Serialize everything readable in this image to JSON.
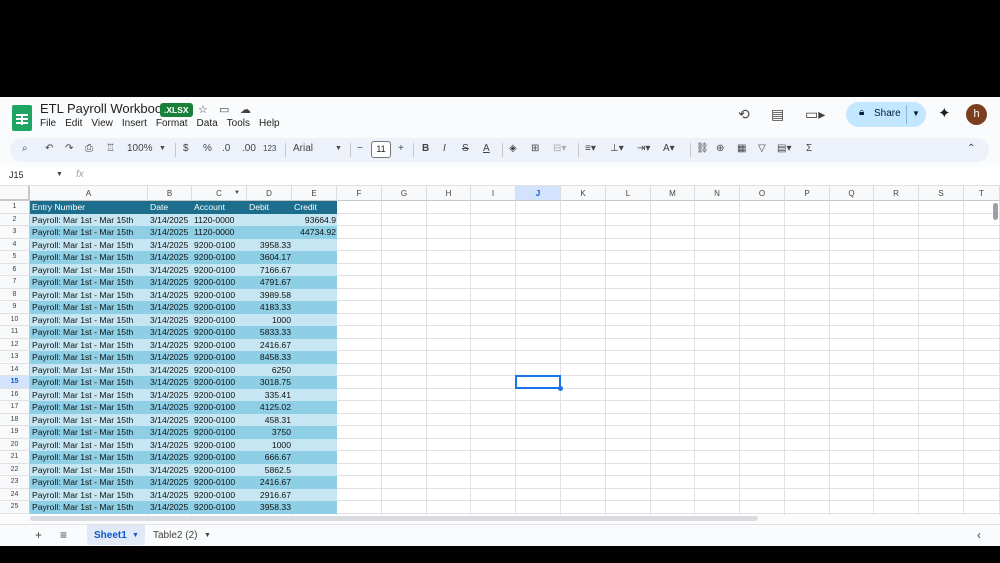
{
  "title": "ETL Payroll Workbook",
  "badge": ".XLSX",
  "menu": [
    "File",
    "Edit",
    "View",
    "Insert",
    "Format",
    "Data",
    "Tools",
    "Help"
  ],
  "share_label": "Share",
  "avatar_initial": "h",
  "toolbar": {
    "zoom": "100%",
    "currency": "$",
    "percent": "%",
    "dec_less": ".0",
    "dec_more": ".00",
    "numfmt": "123",
    "font": "Arial",
    "font_size": "11"
  },
  "name_box": "J15",
  "fx_label": "fx",
  "columns": [
    "A",
    "B",
    "C",
    "D",
    "E",
    "F",
    "G",
    "H",
    "I",
    "J",
    "K",
    "L",
    "M",
    "N",
    "O",
    "P",
    "Q",
    "R",
    "S",
    "T"
  ],
  "selected_column": "J",
  "selected_row": "15",
  "table_header": [
    "Entry Number",
    "Date",
    "Account",
    "Debit",
    "Credit"
  ],
  "rows": [
    [
      "Payroll: Mar 1st - Mar 15th",
      "3/14/2025",
      "1120-0000",
      "",
      "93664.9"
    ],
    [
      "Payroll: Mar 1st - Mar 15th",
      "3/14/2025",
      "1120-0000",
      "",
      "44734.92"
    ],
    [
      "Payroll: Mar 1st - Mar 15th",
      "3/14/2025",
      "9200-0100",
      "3958.33",
      ""
    ],
    [
      "Payroll: Mar 1st - Mar 15th",
      "3/14/2025",
      "9200-0100",
      "3604.17",
      ""
    ],
    [
      "Payroll: Mar 1st - Mar 15th",
      "3/14/2025",
      "9200-0100",
      "7166.67",
      ""
    ],
    [
      "Payroll: Mar 1st - Mar 15th",
      "3/14/2025",
      "9200-0100",
      "4791.67",
      ""
    ],
    [
      "Payroll: Mar 1st - Mar 15th",
      "3/14/2025",
      "9200-0100",
      "3989.58",
      ""
    ],
    [
      "Payroll: Mar 1st - Mar 15th",
      "3/14/2025",
      "9200-0100",
      "4183.33",
      ""
    ],
    [
      "Payroll: Mar 1st - Mar 15th",
      "3/14/2025",
      "9200-0100",
      "1000",
      ""
    ],
    [
      "Payroll: Mar 1st - Mar 15th",
      "3/14/2025",
      "9200-0100",
      "5833.33",
      ""
    ],
    [
      "Payroll: Mar 1st - Mar 15th",
      "3/14/2025",
      "9200-0100",
      "2416.67",
      ""
    ],
    [
      "Payroll: Mar 1st - Mar 15th",
      "3/14/2025",
      "9200-0100",
      "8458.33",
      ""
    ],
    [
      "Payroll: Mar 1st - Mar 15th",
      "3/14/2025",
      "9200-0100",
      "6250",
      ""
    ],
    [
      "Payroll: Mar 1st - Mar 15th",
      "3/14/2025",
      "9200-0100",
      "3018.75",
      ""
    ],
    [
      "Payroll: Mar 1st - Mar 15th",
      "3/14/2025",
      "9200-0100",
      "335.41",
      ""
    ],
    [
      "Payroll: Mar 1st - Mar 15th",
      "3/14/2025",
      "9200-0100",
      "4125.02",
      ""
    ],
    [
      "Payroll: Mar 1st - Mar 15th",
      "3/14/2025",
      "9200-0100",
      "458.31",
      ""
    ],
    [
      "Payroll: Mar 1st - Mar 15th",
      "3/14/2025",
      "9200-0100",
      "3750",
      ""
    ],
    [
      "Payroll: Mar 1st - Mar 15th",
      "3/14/2025",
      "9200-0100",
      "1000",
      ""
    ],
    [
      "Payroll: Mar 1st - Mar 15th",
      "3/14/2025",
      "9200-0100",
      "666.67",
      ""
    ],
    [
      "Payroll: Mar 1st - Mar 15th",
      "3/14/2025",
      "9200-0100",
      "5862.5",
      ""
    ],
    [
      "Payroll: Mar 1st - Mar 15th",
      "3/14/2025",
      "9200-0100",
      "2416.67",
      ""
    ],
    [
      "Payroll: Mar 1st - Mar 15th",
      "3/14/2025",
      "9200-0100",
      "2916.67",
      ""
    ],
    [
      "Payroll: Mar 1st - Mar 15th",
      "3/14/2025",
      "9200-0100",
      "3958.33",
      ""
    ]
  ],
  "colors": {
    "header_bg": "#1c6e8c",
    "band_dark": "#8ecfe6",
    "band_light": "#c5e6f2",
    "accent": "#1a73e8"
  },
  "sheets": [
    "Sheet1",
    "Table2 (2)"
  ],
  "active_sheet": "Sheet1"
}
